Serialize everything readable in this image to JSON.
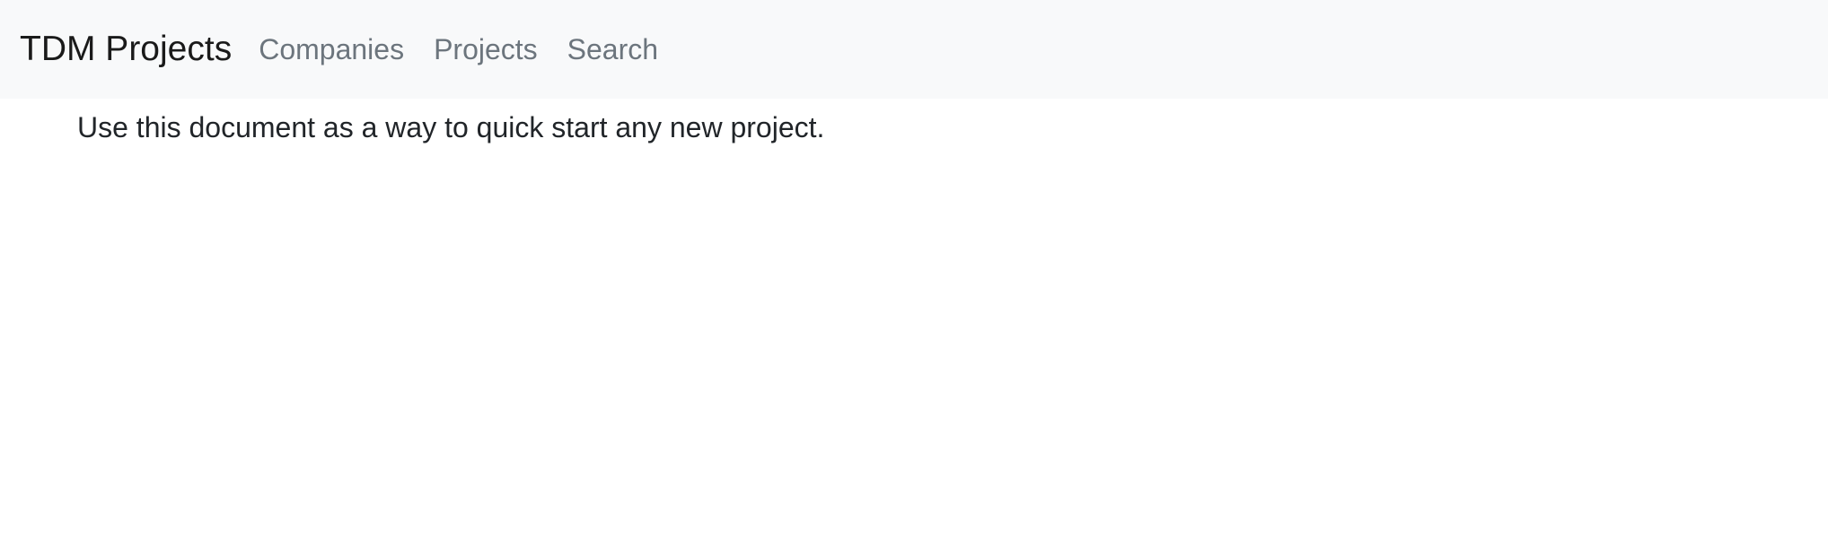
{
  "navbar": {
    "brand": "TDM Projects",
    "links": [
      {
        "label": "Companies"
      },
      {
        "label": "Projects"
      },
      {
        "label": "Search"
      }
    ]
  },
  "main": {
    "intro_text": "Use this document as a way to quick start any new project."
  }
}
